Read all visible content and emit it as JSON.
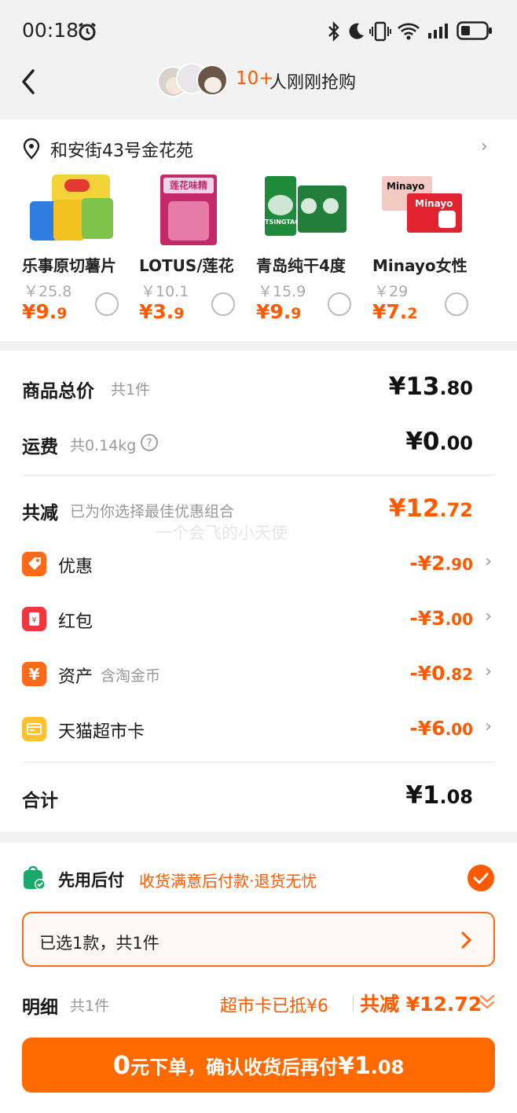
{
  "status": {
    "time": "00:18"
  },
  "header": {
    "count": "10+",
    "text": "人刚刚抢购"
  },
  "address": {
    "text": "和安街43号金花苑"
  },
  "recommend": {
    "items": [
      {
        "name": "乐事原切薯片",
        "old": "￥25.8",
        "price_main": "¥9.",
        "price_dec": "9"
      },
      {
        "name": "LOTUS/莲花",
        "old": "￥10.1",
        "price_main": "¥3.",
        "price_dec": "9"
      },
      {
        "name": "青岛纯干4度",
        "old": "￥15.9",
        "price_main": "¥9.",
        "price_dec": "9"
      },
      {
        "name": "Minayo女性",
        "old": "￥29",
        "price_main": "¥7.",
        "price_dec": "2"
      }
    ],
    "brand_labels": {
      "lotus": "莲花味精",
      "minayo": "Minayo",
      "tsingtao": "TSINGTAO"
    }
  },
  "summary": {
    "goods_label": "商品总价",
    "goods_count": "共1件",
    "goods_main": "¥13",
    "goods_dec": ".80",
    "ship_label": "运费",
    "ship_weight": "共0.14kg",
    "ship_main": "¥0",
    "ship_dec": ".00",
    "reduce_label": "共减",
    "reduce_note": "已为你选择最佳优惠组合",
    "reduce_main": "¥12",
    "reduce_dec": ".72",
    "watermark": "一个会飞的小天使",
    "total_label": "合计",
    "total_main": "¥1",
    "total_dec": ".08"
  },
  "discounts": [
    {
      "label": "优惠",
      "note": "",
      "main": "-¥2",
      "dec": ".90",
      "icon": "tag-icon",
      "color": "#ff6a1a"
    },
    {
      "label": "红包",
      "note": "",
      "main": "-¥3",
      "dec": ".00",
      "icon": "red-packet-icon",
      "color": "#f0373e"
    },
    {
      "label": "资产",
      "note": "含淘金币",
      "main": "-¥0",
      "dec": ".82",
      "icon": "yuan-icon",
      "color": "#ff6a1a"
    },
    {
      "label": "天猫超市卡",
      "note": "",
      "main": "-¥6",
      "dec": ".00",
      "icon": "card-icon",
      "color": "#ffc12e"
    }
  ],
  "payment": {
    "title": "先用后付",
    "desc": "收货满意后付款·退货无忧",
    "selected": "已选1款，共1件"
  },
  "detail": {
    "label": "明细",
    "count": "共1件",
    "card": "超市卡已抵¥6",
    "reduce": "共减 ¥12.72"
  },
  "submit": {
    "zero": "0",
    "text": "元下单，确认收货后再付",
    "main": "¥1",
    "dec": ".08"
  },
  "colors": {
    "accent": "#ff5a00",
    "button": "#ff6a00"
  }
}
